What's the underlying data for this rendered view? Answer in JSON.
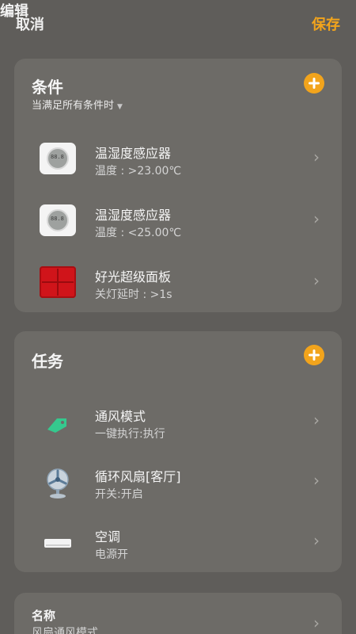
{
  "header": {
    "cancel_label": "取消",
    "title": "编辑",
    "save_label": "保存"
  },
  "conditions": {
    "title": "条件",
    "subtitle": "当满足所有条件时",
    "items": [
      {
        "name": "温湿度感应器",
        "detail": "温度 : >23.00℃",
        "icon": "temperature-humidity-sensor-icon"
      },
      {
        "name": "温湿度感应器",
        "detail": "温度 : <25.00℃",
        "icon": "temperature-humidity-sensor-icon"
      },
      {
        "name": "好光超级面板",
        "detail": "关灯延时 : >1s",
        "icon": "red-switch-panel-icon"
      }
    ]
  },
  "tasks": {
    "title": "任务",
    "items": [
      {
        "name": "通风模式",
        "detail": "一键执行:执行",
        "icon": "scene-tag-icon"
      },
      {
        "name": "循环风扇[客厅]",
        "detail": "开关:开启",
        "icon": "fan-icon"
      },
      {
        "name": "空调",
        "detail": "电源开",
        "icon": "air-conditioner-icon"
      }
    ]
  },
  "name_card": {
    "label": "名称",
    "value": "风扇通风模式"
  },
  "colors": {
    "accent": "#f2a41c",
    "background": "#5f5d5a",
    "card": "#6d6b67"
  }
}
